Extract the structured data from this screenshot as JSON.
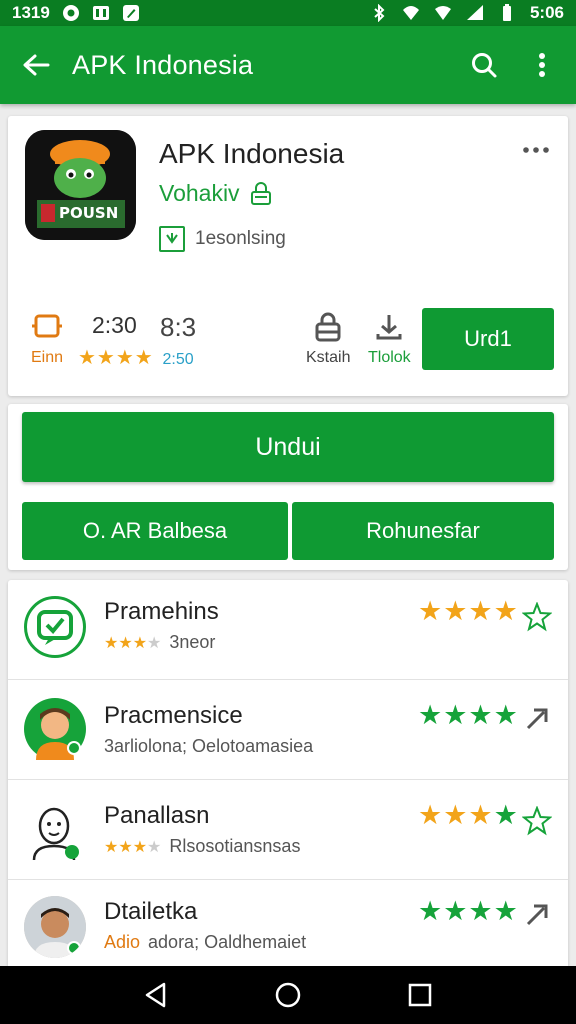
{
  "status_bar": {
    "time_left": "1319",
    "time_right": "5:06"
  },
  "app_bar": {
    "title": "APK Indonesia"
  },
  "app": {
    "name": "APK Indonesia",
    "developer": "Vohakiv",
    "category": "1esonlsing",
    "icon_text": "POUSN",
    "stats": {
      "a_value": "2:30",
      "a_label": "Einn",
      "b_value": "8:3",
      "b_label": "2:50",
      "c_label": "Kstaih",
      "d_label": "Tlolok"
    },
    "install_label": "Urd1"
  },
  "actions": {
    "primary_label": "Undui",
    "left_label": "O. AR Balbesa",
    "right_label": "Rohunesfar"
  },
  "list": [
    {
      "name": "Pramehins",
      "subtitle": "3neor",
      "stars": "★★★★",
      "star_color": "orange",
      "end_icon": "star-outline-icon"
    },
    {
      "name": "Pracmensice",
      "subtitle": "3arliolona; Oelotoamasiea",
      "stars": "★★★★",
      "star_color": "green",
      "end_icon": "share-icon"
    },
    {
      "name": "Panallasn",
      "subtitle": "Rlsosotiansnsas",
      "stars": "★★★★",
      "star_color": "mixed",
      "end_icon": "star-outline-icon"
    },
    {
      "name": "Dtailetka",
      "subtitle_accent": "Adio",
      "subtitle": "adora; Oaldhemaiet",
      "stars": "★★★★",
      "star_color": "green",
      "end_icon": "share-icon"
    }
  ],
  "colors": {
    "status_bar": "#0a7d22",
    "app_bar": "#119a32",
    "accent": "#0f9a33",
    "star_orange": "#f2a41a",
    "star_green": "#16a33a"
  }
}
